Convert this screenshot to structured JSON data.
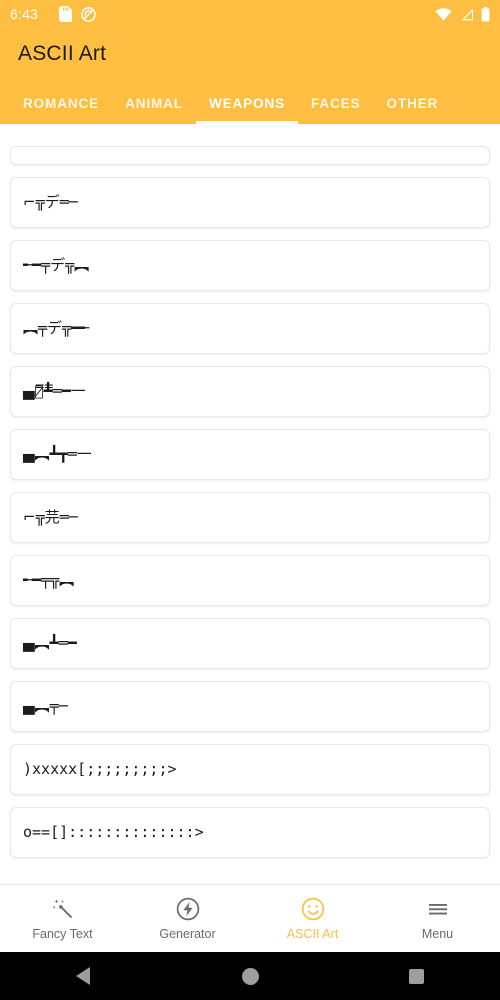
{
  "status_bar": {
    "time": "6:43",
    "icons_left": [
      "sd-card-icon",
      "rotation-lock-off-icon"
    ],
    "icons_right": [
      "wifi-icon",
      "cell-signal-icon",
      "battery-icon"
    ],
    "background_color": "#FDBE42",
    "foreground_color": "#FFFFFF"
  },
  "app_bar": {
    "title": "ASCII Art",
    "background_color": "#FDBE42",
    "title_color": "#1A1A1A"
  },
  "tabs": {
    "active_index": 2,
    "indicator_color": "#FFFFFF",
    "items": [
      {
        "label": "ROMANCE"
      },
      {
        "label": "ANIMAL"
      },
      {
        "label": "WEAPONS"
      },
      {
        "label": "FACES"
      },
      {
        "label": "OTHER"
      }
    ]
  },
  "list": {
    "items": [
      {
        "art": "",
        "partial": true
      },
      {
        "art": "⌐╦デ═─"
      },
      {
        "art": "╾━╤デ╦︻"
      },
      {
        "art": "︻╤デ╦━╾"
      },
      {
        "art": "▄︻̷̿┻̿═━一"
      },
      {
        "art": "▄︻┻┳═一"
      },
      {
        "art": "⌐╦芫═─"
      },
      {
        "art": "╾━╤╦︻"
      },
      {
        "art": "▄︻┻═━"
      },
      {
        "art": "▄︻╤─"
      },
      {
        "art": ")xxxxx[;;;;;;;;;>",
        "mono": true
      },
      {
        "art": "o==[]::::::::::::::>",
        "mono": true
      }
    ]
  },
  "bottom_nav": {
    "active_index": 2,
    "active_color": "#FDBE42",
    "inactive_color": "#6B6B6B",
    "items": [
      {
        "label": "Fancy Text",
        "icon": "magic-wand-icon"
      },
      {
        "label": "Generator",
        "icon": "lightning-bolt-circle-icon"
      },
      {
        "label": "ASCII Art",
        "icon": "smiley-face-icon"
      },
      {
        "label": "Menu",
        "icon": "hamburger-menu-icon"
      }
    ]
  },
  "android_nav": {
    "background_color": "#000000",
    "buttons": [
      {
        "name": "back",
        "icon": "triangle-back-icon"
      },
      {
        "name": "home",
        "icon": "circle-home-icon"
      },
      {
        "name": "recents",
        "icon": "square-recents-icon"
      }
    ]
  }
}
